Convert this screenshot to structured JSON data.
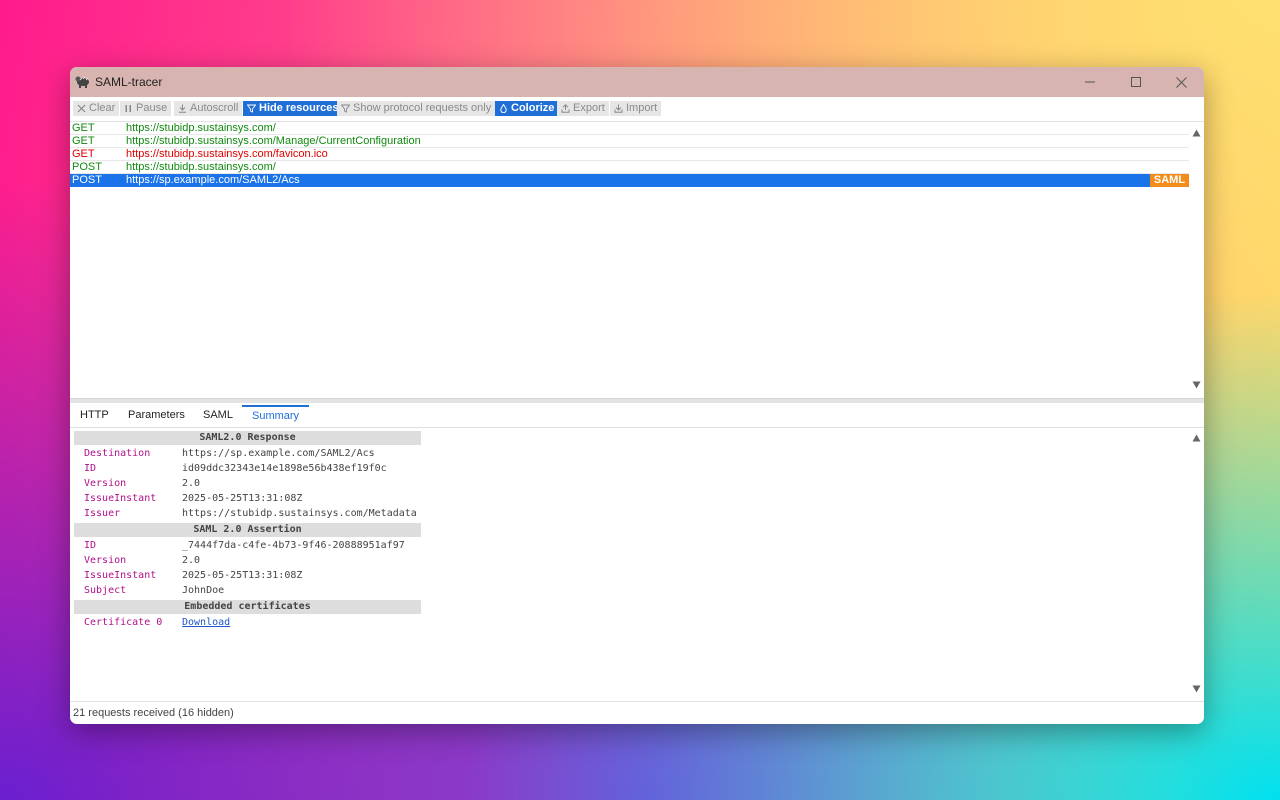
{
  "window": {
    "title": "SAML-tracer"
  },
  "toolbar": {
    "clear": "Clear",
    "pause": "Pause",
    "autoscroll": "Autoscroll",
    "hide_resources": "Hide resources",
    "show_protocol": "Show protocol requests only",
    "colorize": "Colorize",
    "export": "Export",
    "import": "Import"
  },
  "requests": [
    {
      "method": "GET",
      "url": "https://stubidp.sustainsys.com/"
    },
    {
      "method": "GET",
      "url": "https://stubidp.sustainsys.com/Manage/CurrentConfiguration"
    },
    {
      "method": "GET",
      "url": "https://stubidp.sustainsys.com/favicon.ico"
    },
    {
      "method": "POST",
      "url": "https://stubidp.sustainsys.com/"
    },
    {
      "method": "POST",
      "url": "https://sp.example.com/SAML2/Acs",
      "badge": "SAML"
    }
  ],
  "tabs": [
    "HTTP",
    "Parameters",
    "SAML",
    "Summary"
  ],
  "summary": {
    "response_header": "SAML2.0 Response",
    "response": [
      {
        "k": "Destination",
        "v": "https://sp.example.com/SAML2/Acs"
      },
      {
        "k": "ID",
        "v": "id09ddc32343e14e1898e56b438ef19f0c"
      },
      {
        "k": "Version",
        "v": "2.0"
      },
      {
        "k": "IssueInstant",
        "v": "2025-05-25T13:31:08Z"
      },
      {
        "k": "Issuer",
        "v": "https://stubidp.sustainsys.com/Metadata"
      }
    ],
    "assertion_header": "SAML 2.0 Assertion",
    "assertion": [
      {
        "k": "ID",
        "v": "_7444f7da-c4fe-4b73-9f46-20888951af97"
      },
      {
        "k": "Version",
        "v": "2.0"
      },
      {
        "k": "IssueInstant",
        "v": "2025-05-25T13:31:08Z"
      },
      {
        "k": "Subject",
        "v": "JohnDoe"
      }
    ],
    "certs_header": "Embedded certificates",
    "certs": [
      {
        "k": "Certificate 0",
        "v": "Download"
      }
    ]
  },
  "status": "21 requests received (16 hidden)"
}
